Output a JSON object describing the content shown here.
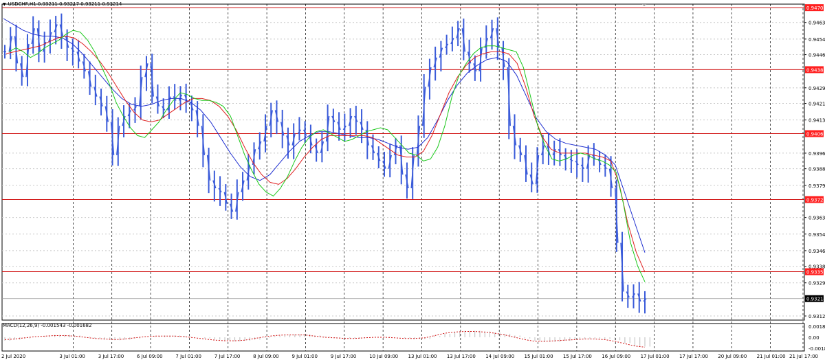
{
  "chart": {
    "symbol_line": "USDCHF,H1  0.93211 0.93217 0.93211 0.93214",
    "current_price_label": "0.93214",
    "colors": {
      "background": "#ffffff",
      "grid": "#c8c8c8",
      "vgrid": "#000000",
      "candles": "#3a5bd9",
      "ma_fast": "#19c819",
      "ma_mid": "#e02020",
      "ma_slow": "#2030d0",
      "hline": "#d01010",
      "macd_hist": "#bbbbbb",
      "macd_signal": "#d01010"
    }
  },
  "chart_data": [
    {
      "type": "line",
      "title": "USDCHF,H1",
      "y_axis_ticks": [
        "0.94630",
        "0.94545",
        "0.94465",
        "0.94295",
        "0.94215",
        "0.94130",
        "0.93960",
        "0.93880",
        "0.93795",
        "0.93630",
        "0.93545",
        "0.93460",
        "0.93380",
        "0.93295",
        "0.93125"
      ],
      "ylim": [
        0.93125,
        0.9471
      ],
      "horizontal_levels": [
        {
          "value": 0.94706,
          "label": "0.94706"
        },
        {
          "value": 0.94388,
          "label": "0.94388"
        },
        {
          "value": 0.9406,
          "label": "0.94060"
        },
        {
          "value": 0.93722,
          "label": "0.93722"
        },
        {
          "value": 0.93352,
          "label": "0.93352"
        }
      ],
      "x_axis_labels": [
        "2 Jul 2020",
        "3 Jul 01:00",
        "3 Jul 17:00",
        "6 Jul 09:00",
        "7 Jul 01:00",
        "7 Jul 17:00",
        "8 Jul 09:00",
        "9 Jul 01:00",
        "9 Jul 17:00",
        "10 Jul 09:00",
        "13 Jul 01:00",
        "13 Jul 17:00",
        "14 Jul 09:00",
        "15 Jul 01:00",
        "15 Jul 17:00",
        "16 Jul 09:00",
        "17 Jul 01:00",
        "17 Jul 17:00",
        "20 Jul 09:00",
        "21 Jul 01:00",
        "21 Jul 17:00"
      ],
      "price_path": [
        0.9448,
        0.9456,
        0.9442,
        0.9435,
        0.9452,
        0.946,
        0.9448,
        0.9453,
        0.9458,
        0.9462,
        0.9456,
        0.945,
        0.9448,
        0.9443,
        0.9438,
        0.943,
        0.9425,
        0.942,
        0.9412,
        0.9395,
        0.941,
        0.9415,
        0.9418,
        0.942,
        0.9435,
        0.9442,
        0.9425,
        0.942,
        0.9418,
        0.9425,
        0.9423,
        0.9426,
        0.9422,
        0.9418,
        0.941,
        0.9395,
        0.9382,
        0.9378,
        0.9376,
        0.937,
        0.9366,
        0.9376,
        0.9382,
        0.939,
        0.9398,
        0.9402,
        0.941,
        0.9418,
        0.9412,
        0.9405,
        0.94,
        0.9406,
        0.9408,
        0.9405,
        0.94,
        0.9396,
        0.9402,
        0.9415,
        0.9412,
        0.9408,
        0.941,
        0.9415,
        0.9412,
        0.9408,
        0.94,
        0.9396,
        0.9392,
        0.9388,
        0.9395,
        0.94,
        0.9385,
        0.9378,
        0.9395,
        0.941,
        0.943,
        0.944,
        0.9445,
        0.945,
        0.9452,
        0.9455,
        0.946,
        0.9448,
        0.9442,
        0.9438,
        0.945,
        0.9455,
        0.946,
        0.945,
        0.944,
        0.941,
        0.94,
        0.9395,
        0.9385,
        0.938,
        0.9395,
        0.94,
        0.9395,
        0.9398,
        0.9395,
        0.9393,
        0.9392,
        0.939,
        0.9388,
        0.9395,
        0.9393,
        0.939,
        0.9388,
        0.9378,
        0.935,
        0.9325,
        0.9322,
        0.9324,
        0.932,
        0.93214
      ],
      "ma_fast": [
        0.9448,
        0.945,
        0.9448,
        0.9445,
        0.9447,
        0.945,
        0.9452,
        0.9454,
        0.9457,
        0.9459,
        0.9458,
        0.9454,
        0.9448,
        0.944,
        0.9432,
        0.9422,
        0.9415,
        0.9409,
        0.9405,
        0.9404,
        0.9408,
        0.9412,
        0.9418,
        0.9423,
        0.9427,
        0.9426,
        0.9424,
        0.9423,
        0.9423,
        0.9422,
        0.942,
        0.9415,
        0.9405,
        0.9395,
        0.9387,
        0.938,
        0.9376,
        0.9374,
        0.9378,
        0.9384,
        0.9392,
        0.9399,
        0.9404,
        0.9407,
        0.9408,
        0.9406,
        0.9404,
        0.9402,
        0.9403,
        0.9405,
        0.9407,
        0.9408,
        0.9409,
        0.9408,
        0.9404,
        0.94,
        0.9396,
        0.9395,
        0.9392,
        0.9393,
        0.9399,
        0.941,
        0.9425,
        0.9436,
        0.9442,
        0.9447,
        0.945,
        0.9451,
        0.9451,
        0.945,
        0.9449,
        0.9448,
        0.944,
        0.9425,
        0.941,
        0.94,
        0.9393,
        0.9392,
        0.9393,
        0.9395,
        0.9396,
        0.9395,
        0.9393,
        0.9392,
        0.939,
        0.9386,
        0.937,
        0.935,
        0.9338,
        0.933
      ],
      "ma_mid": [
        0.9447,
        0.9448,
        0.9449,
        0.945,
        0.9451,
        0.9453,
        0.9455,
        0.9456,
        0.9455,
        0.9452,
        0.9448,
        0.9443,
        0.9437,
        0.943,
        0.9423,
        0.9417,
        0.9413,
        0.9412,
        0.9413,
        0.9416,
        0.9419,
        0.9422,
        0.9424,
        0.9424,
        0.9423,
        0.942,
        0.9415,
        0.9408,
        0.9399,
        0.9391,
        0.9385,
        0.9381,
        0.938,
        0.9383,
        0.9388,
        0.9394,
        0.9399,
        0.9403,
        0.9405,
        0.9405,
        0.9405,
        0.9405,
        0.9405,
        0.9404,
        0.9401,
        0.9398,
        0.9395,
        0.9394,
        0.9394,
        0.9397,
        0.9405,
        0.9416,
        0.9427,
        0.9435,
        0.9441,
        0.9445,
        0.9447,
        0.9448,
        0.9448,
        0.9447,
        0.9442,
        0.943,
        0.9415,
        0.9404,
        0.9398,
        0.9396,
        0.9396,
        0.9396,
        0.9396,
        0.9395,
        0.9394,
        0.9392,
        0.938,
        0.936,
        0.9345,
        0.9335
      ],
      "ma_slow": [
        0.9465,
        0.9462,
        0.9459,
        0.9457,
        0.9456,
        0.9456,
        0.9455,
        0.9452,
        0.9447,
        0.9441,
        0.9435,
        0.9429,
        0.9424,
        0.9421,
        0.942,
        0.9421,
        0.9423,
        0.9424,
        0.9424,
        0.9422,
        0.9418,
        0.9412,
        0.9404,
        0.9396,
        0.9389,
        0.9384,
        0.9382,
        0.9385,
        0.9391,
        0.9397,
        0.9402,
        0.9405,
        0.9407,
        0.9407,
        0.9406,
        0.9405,
        0.9404,
        0.9404,
        0.9403,
        0.9401,
        0.9399,
        0.9398,
        0.9399,
        0.9404,
        0.9413,
        0.9423,
        0.9431,
        0.9437,
        0.9441,
        0.9444,
        0.9445,
        0.9443,
        0.9436,
        0.9425,
        0.9414,
        0.9407,
        0.9403,
        0.9401,
        0.94,
        0.9399,
        0.9398,
        0.9395,
        0.939,
        0.9375,
        0.936,
        0.9345
      ]
    },
    {
      "type": "area",
      "title": "MACD(12,26,9) -0.001543 -0.001682",
      "y_axis_ticks": [
        "0.00189",
        "0.00",
        "-0.00189"
      ],
      "ylim": [
        -0.00189,
        0.00189
      ],
      "macd_hist": [
        -0.0006,
        -0.0004,
        -0.0002,
        0.0,
        0.0002,
        0.0004,
        0.0004,
        0.0003,
        0.0001,
        -0.0002,
        -0.0004,
        -0.0005,
        -0.0004,
        -0.0002,
        0.0,
        0.0002,
        0.0003,
        0.0003,
        0.0002,
        0.0,
        -0.0002,
        -0.0004,
        -0.0006,
        -0.0007,
        -0.0006,
        -0.0004,
        -0.0001,
        0.0002,
        0.0004,
        0.0005,
        0.0005,
        0.0003,
        0.0001,
        -0.0001,
        -0.0002,
        -0.0002,
        -0.0001,
        0.0,
        0.0001,
        0.0,
        -0.0002,
        -0.0003,
        -0.0003,
        0.0002,
        0.0006,
        0.0009,
        0.0011,
        0.0011,
        0.001,
        0.0008,
        0.0006,
        0.0003,
        -0.0002,
        -0.0006,
        -0.0008,
        -0.0008,
        -0.0006,
        -0.0004,
        -0.0003,
        -0.0002,
        -0.0003,
        -0.0005,
        -0.001,
        -0.0015,
        -0.0016
      ],
      "macd_signal": [
        -0.0004,
        -0.0003,
        -0.0001,
        0.0001,
        0.0002,
        0.0003,
        0.0003,
        0.0002,
        0.0,
        -0.0002,
        -0.0003,
        -0.0004,
        -0.0003,
        -0.0001,
        0.0001,
        0.0002,
        0.0002,
        0.0002,
        0.0001,
        -0.0001,
        -0.0003,
        -0.0005,
        -0.0006,
        -0.0006,
        -0.0005,
        -0.0002,
        0.0001,
        0.0003,
        0.0004,
        0.0004,
        0.0004,
        0.0002,
        0.0,
        -0.0001,
        -0.0002,
        -0.0002,
        -0.0001,
        0.0,
        0.0,
        -0.0001,
        -0.0002,
        -0.0002,
        -0.0001,
        0.0003,
        0.0007,
        0.0009,
        0.001,
        0.001,
        0.0009,
        0.0007,
        0.0004,
        0.0,
        -0.0004,
        -0.0007,
        -0.0007,
        -0.0006,
        -0.0005,
        -0.0004,
        -0.0003,
        -0.0003,
        -0.0004,
        -0.0007,
        -0.0011,
        -0.0015,
        -0.0017
      ]
    }
  ]
}
